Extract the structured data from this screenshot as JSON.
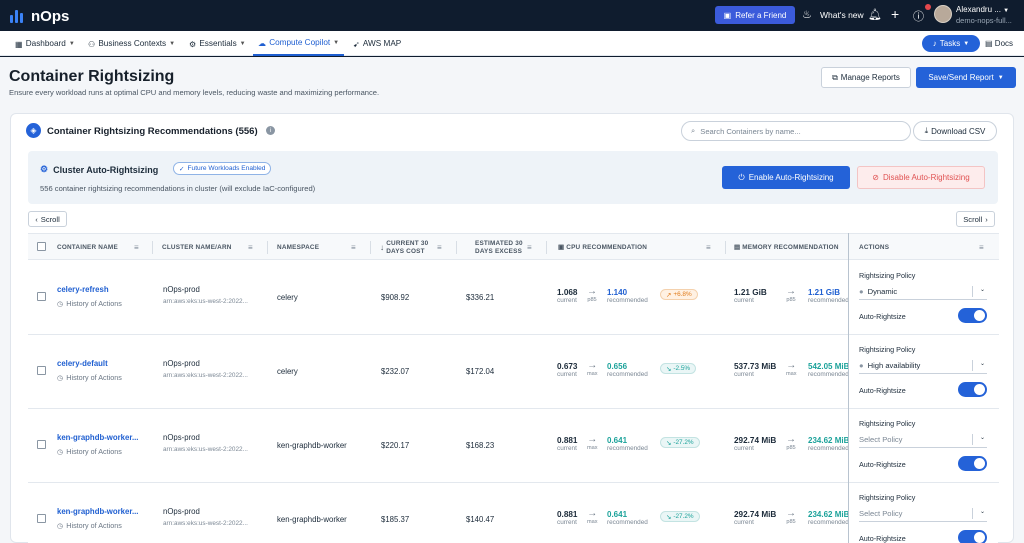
{
  "brand": {
    "name": "nOps"
  },
  "topbar": {
    "refer_label": "Refer a Friend",
    "whats_new_label": "What's new",
    "user_name": "Alexandru ...",
    "user_org": "demo-nops-full..."
  },
  "nav": {
    "items": [
      {
        "label": "Dashboard"
      },
      {
        "label": "Business Contexts"
      },
      {
        "label": "Essentials"
      },
      {
        "label": "Compute Copilot"
      },
      {
        "label": "AWS MAP"
      }
    ],
    "tasks_label": "Tasks",
    "docs_label": "Docs"
  },
  "page": {
    "title": "Container Rightsizing",
    "subtitle": "Ensure every workload runs at optimal CPU and memory levels, reducing waste and maximizing performance.",
    "manage_reports_label": "Manage Reports",
    "save_send_label": "Save/Send Report"
  },
  "card": {
    "title": "Container Rightsizing Recommendations (556)",
    "search_placeholder": "Search Containers by name...",
    "download_label": "Download CSV"
  },
  "auto": {
    "title": "Cluster Auto-Rightsizing",
    "badge": "Future Workloads Enabled",
    "subtitle": "556 container rightsizing recommendations in cluster (will exclude IaC-configured)",
    "enable_label": "Enable Auto-Rightsizing",
    "disable_label": "Disable Auto-Rightsizing"
  },
  "scroll": {
    "left_label": "Scroll",
    "right_label": "Scroll"
  },
  "table": {
    "headers": {
      "container": "CONTAINER NAME",
      "cluster": "CLUSTER NAME/ARN",
      "namespace": "NAMESPACE",
      "cost_1": "CURRENT 30",
      "cost_2": "DAYS COST",
      "excess_1": "ESTIMATED 30",
      "excess_2": "DAYS EXCESS",
      "cpu": "CPU RECOMMENDATION",
      "mem": "MEMORY RECOMMENDATION",
      "actions": "ACTIONS"
    },
    "history_label": "History of Actions",
    "current_label": "current",
    "recommended_label": "recommended",
    "policy_label": "Rightsizing Policy",
    "auto_label": "Auto-Rightsize",
    "rows": [
      {
        "name": "celery-refresh",
        "cluster": "nOps-prod",
        "arn": "arn:aws:eks:us-west-2:2022...",
        "namespace": "celery",
        "cost": "$908.92",
        "excess": "$336.21",
        "cpu_current": "1.068",
        "cpu_stat": "p85",
        "cpu_rec": "1.140",
        "cpu_pct": "+6.8%",
        "cpu_dir": "up",
        "mem_current": "1.21 GiB",
        "mem_stat": "p85",
        "mem_rec": "1.21 GiB",
        "policy": "Dynamic",
        "auto_on": true
      },
      {
        "name": "celery-default",
        "cluster": "nOps-prod",
        "arn": "arn:aws:eks:us-west-2:2022...",
        "namespace": "celery",
        "cost": "$232.07",
        "excess": "$172.04",
        "cpu_current": "0.673",
        "cpu_stat": "max",
        "cpu_rec": "0.656",
        "cpu_pct": "-2.5%",
        "cpu_dir": "down",
        "mem_current": "537.73 MiB",
        "mem_stat": "max",
        "mem_rec": "542.05 MiB",
        "policy": "High availability",
        "auto_on": true
      },
      {
        "name": "ken-graphdb-worker...",
        "cluster": "nOps-prod",
        "arn": "arn:aws:eks:us-west-2:2022...",
        "namespace": "ken-graphdb-worker",
        "cost": "$220.17",
        "excess": "$168.23",
        "cpu_current": "0.881",
        "cpu_stat": "max",
        "cpu_rec": "0.641",
        "cpu_pct": "-27.2%",
        "cpu_dir": "down",
        "mem_current": "292.74 MiB",
        "mem_stat": "p85",
        "mem_rec": "234.62 MiB",
        "policy": "Select Policy",
        "auto_on": true
      },
      {
        "name": "ken-graphdb-worker...",
        "cluster": "nOps-prod",
        "arn": "arn:aws:eks:us-west-2:2022...",
        "namespace": "ken-graphdb-worker",
        "cost": "$185.37",
        "excess": "$140.47",
        "cpu_current": "0.881",
        "cpu_stat": "max",
        "cpu_rec": "0.641",
        "cpu_pct": "-27.2%",
        "cpu_dir": "down",
        "mem_current": "292.74 MiB",
        "mem_stat": "p85",
        "mem_rec": "234.62 MiB",
        "policy": "Select Policy",
        "auto_on": true
      }
    ]
  }
}
